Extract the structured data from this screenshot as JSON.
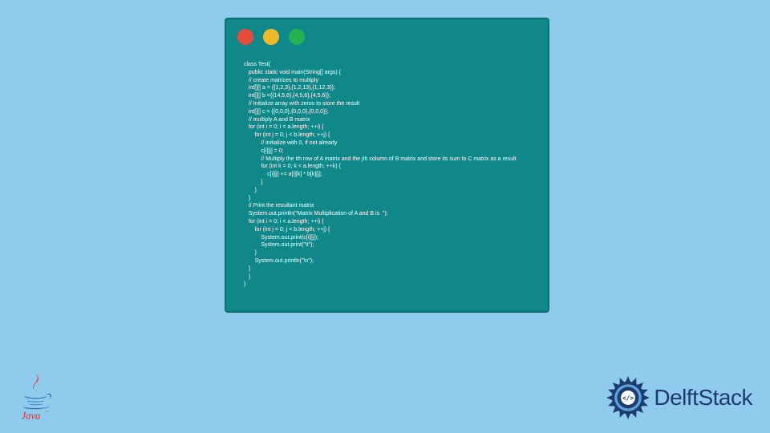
{
  "code_window": {
    "code_text": "class Test{\n   public static void main(String[] args) {\n   // create matrices to multiply\n   int[][] a = {{1,2,3},{1,2,13},{1,12,3}};\n   int[][] b ={{14,5,6},{4,5,6},{4,5,6}};\n   // Initialize array with zeros to store the result\n   int[][] c = {{0,0,0},{0,0,0},{0,0,0}};\n   // multiply A and B matrix\n   for (int i = 0; i < a.length; ++i) {\n       for (int j = 0; j < b.length; ++j) {\n           // initialize with 0, if not already\n           c[i][j] = 0;\n           // Multiply the ith row of A matrix and the jth column of B matrix and store its sum to C matrix as a result\n           for (int k = 0; k < a.length; ++k) {\n               c[i][j] += a[i][k] * b[k][j];\n           }\n       }\n   }\n   // Print the resultant matrix\n   System.out.println(\"Matrix Multiplication of A and B is  \");\n   for (int i = 0; i < a.length; ++i) {\n       for (int j = 0; j < b.length; ++j) {\n           System.out.print(c[i][j]);\n           System.out.print(\"\\t\");\n       }\n       System.out.println(\"\\n\");\n   }\n   }\n}"
  },
  "logos": {
    "java_label": "Java",
    "delft_label": "DelftStack"
  },
  "colors": {
    "page_bg": "#8fcbed",
    "window_bg": "#108788",
    "red": "#e64c3c",
    "yellow": "#f0b929",
    "green": "#24b151",
    "delft_blue": "#1f3a6e"
  }
}
